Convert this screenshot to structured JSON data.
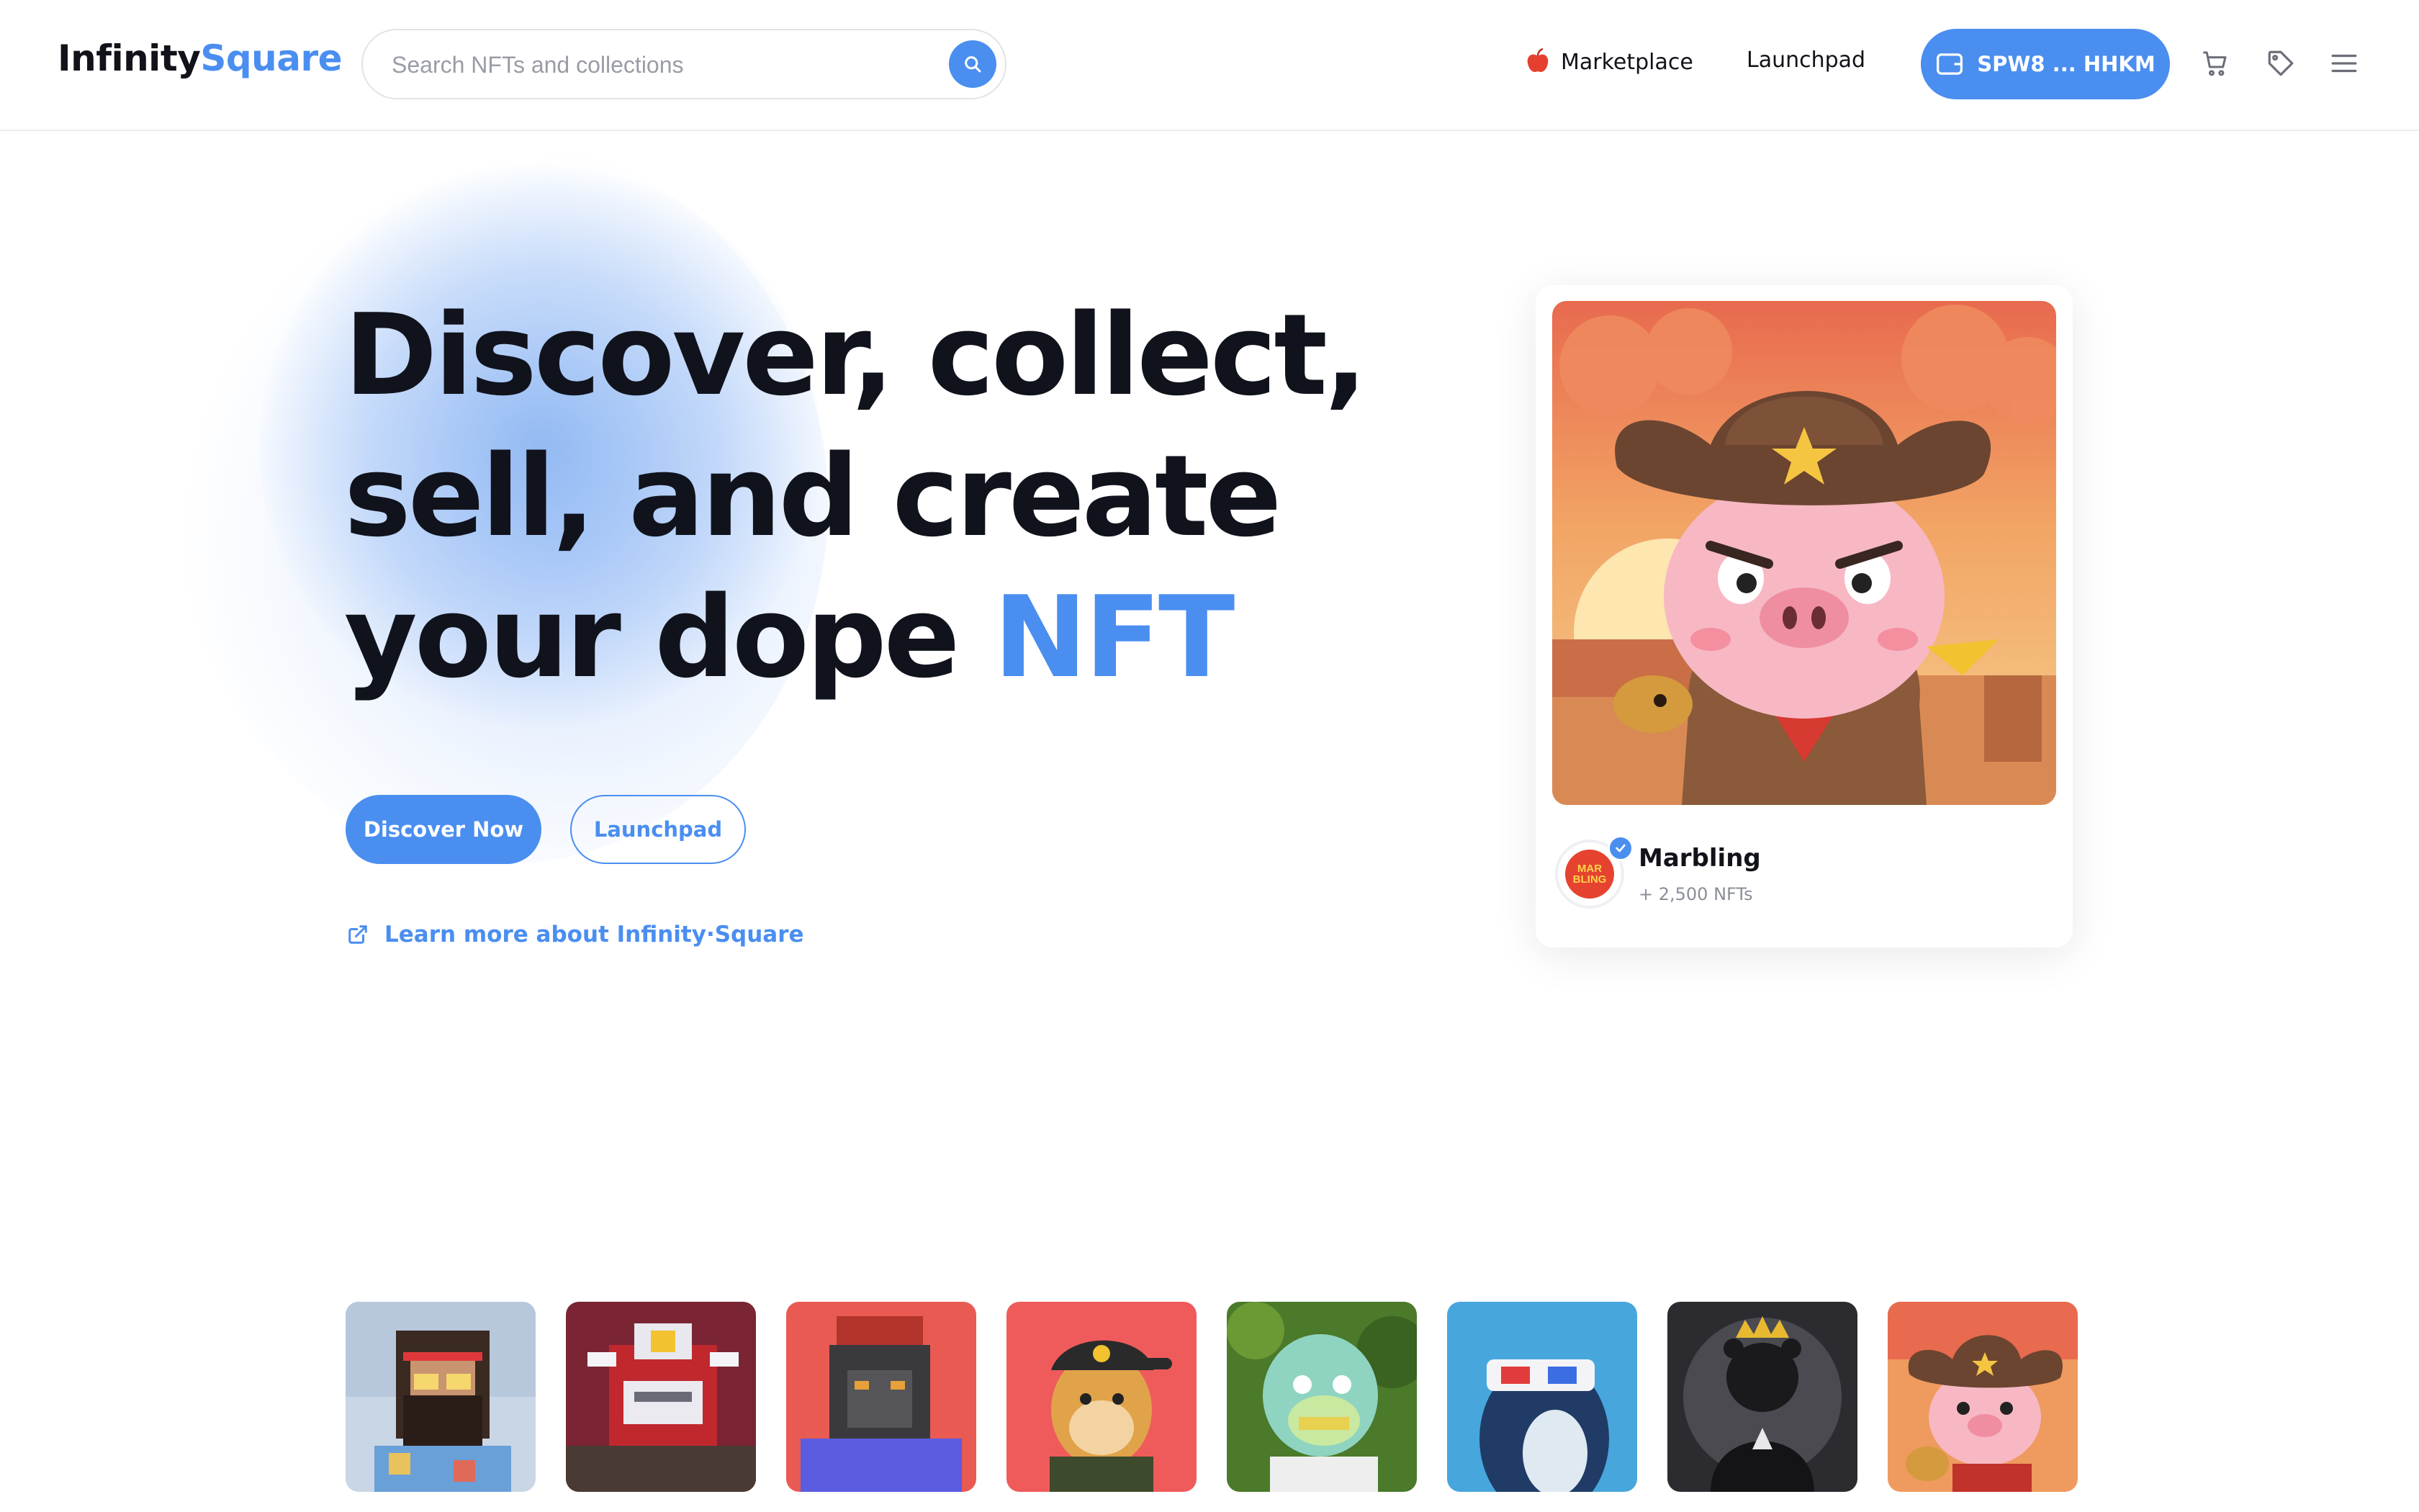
{
  "header": {
    "logo_part1": "Infinity",
    "logo_part2": "Square",
    "search_placeholder": "Search NFTs and collections",
    "nav_marketplace": "Marketplace",
    "nav_launchpad": "Launchpad",
    "wallet_label": "SPW8 ... HHKM",
    "icons": [
      "search-icon",
      "wallet-icon",
      "cart-icon",
      "tag-icon",
      "menu-icon"
    ]
  },
  "hero": {
    "line1": "Discover, collect,",
    "line2": "sell, and create",
    "line3_prefix": "your dope ",
    "line3_accent": "NFT",
    "btn_discover": "Discover Now",
    "btn_launchpad": "Launchpad",
    "learn_more": "Learn more about Infinity·Square"
  },
  "featured": {
    "collection_name": "Marbling",
    "nft_count": "+ 2,500 NFTs",
    "avatar_text": "MAR BLING",
    "image": "cowboy-pig-nft"
  },
  "thumbnails": [
    {
      "name": "pixel-bearded-man"
    },
    {
      "name": "pixel-red-robot"
    },
    {
      "name": "pixel-gorilla"
    },
    {
      "name": "monkey-cap"
    },
    {
      "name": "zombie-ape"
    },
    {
      "name": "whale-3d-glasses"
    },
    {
      "name": "bear-king"
    },
    {
      "name": "cowboy-pig"
    }
  ],
  "colors": {
    "accent": "#4a8ef0",
    "text": "#11131c",
    "muted": "#8b8e98"
  }
}
